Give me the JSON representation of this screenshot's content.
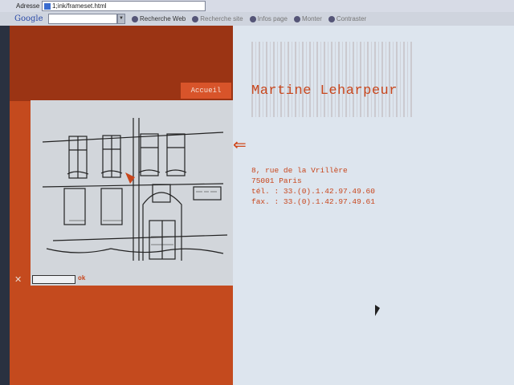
{
  "browser": {
    "address_label": "Adresse",
    "address_value": "1;ink/frameset.html",
    "toolbar_logo": "Google",
    "toolbar_buttons": [
      "Recherche Web",
      "Recherche site",
      "Infos page",
      "Monter",
      "Contraster"
    ]
  },
  "site": {
    "nav_accueil": "Accueil",
    "title": "Martine Leharpeur",
    "back_arrow": "⇐",
    "close_symbol": "✕",
    "ok_label": "ok",
    "address_lines": [
      "8, rue de la Vrillère",
      "75001 Paris",
      "tél. : 33.(0).1.42.97.49.60",
      "fax. : 33.(0).1.42.97.49.61"
    ]
  },
  "colors": {
    "accent": "#c8461c",
    "panel_left": "#c44a1e",
    "panel_right": "#dde5ee"
  }
}
